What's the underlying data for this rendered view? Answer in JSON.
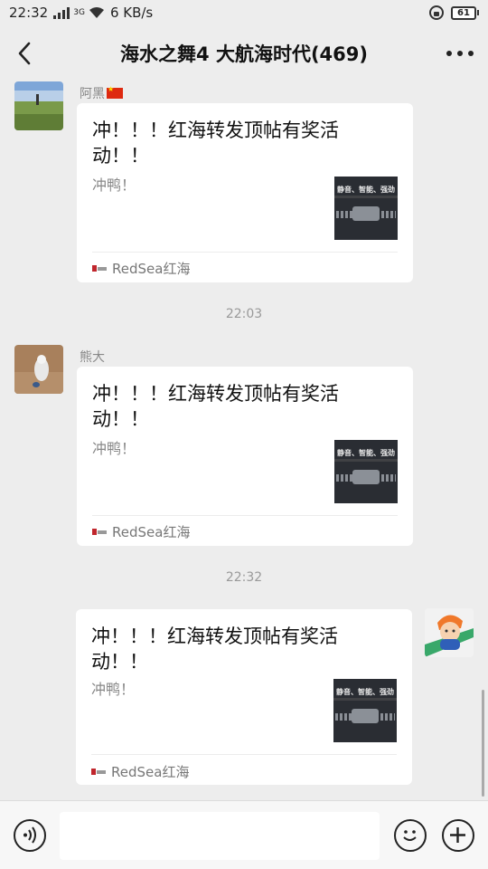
{
  "status_bar": {
    "time": "22:32",
    "network": "3G",
    "speed": "6 KB/s",
    "battery": "61"
  },
  "header": {
    "title": "海水之舞4 大航海时代(469)"
  },
  "messages": [
    {
      "sender": "阿黑",
      "card": {
        "title": "冲！！！红海转发顶帖有奖活动！！",
        "desc": "冲鸭！",
        "thumb_text": "静音、智能、强劲",
        "source": "RedSea红海"
      }
    },
    {
      "timestamp": "22:03",
      "sender": "熊大",
      "card": {
        "title": "冲！！！红海转发顶帖有奖活动！！",
        "desc": "冲鸭！",
        "thumb_text": "静音、智能、强劲",
        "source": "RedSea红海"
      }
    },
    {
      "timestamp": "22:32",
      "card": {
        "title": "冲！！！红海转发顶帖有奖活动！！",
        "desc": "冲鸭！",
        "thumb_text": "静音、智能、强劲",
        "source": "RedSea红海"
      }
    }
  ],
  "input_bar": {
    "placeholder": ""
  },
  "icons": {
    "back": "chevron-left-icon",
    "more": "more-dots-icon",
    "voice": "voice-icon",
    "emoji": "emoji-icon",
    "plus": "plus-icon"
  },
  "colors": {
    "background": "#ededed",
    "card": "#ffffff",
    "flag": "#de2910",
    "brand": "#c0262d"
  }
}
